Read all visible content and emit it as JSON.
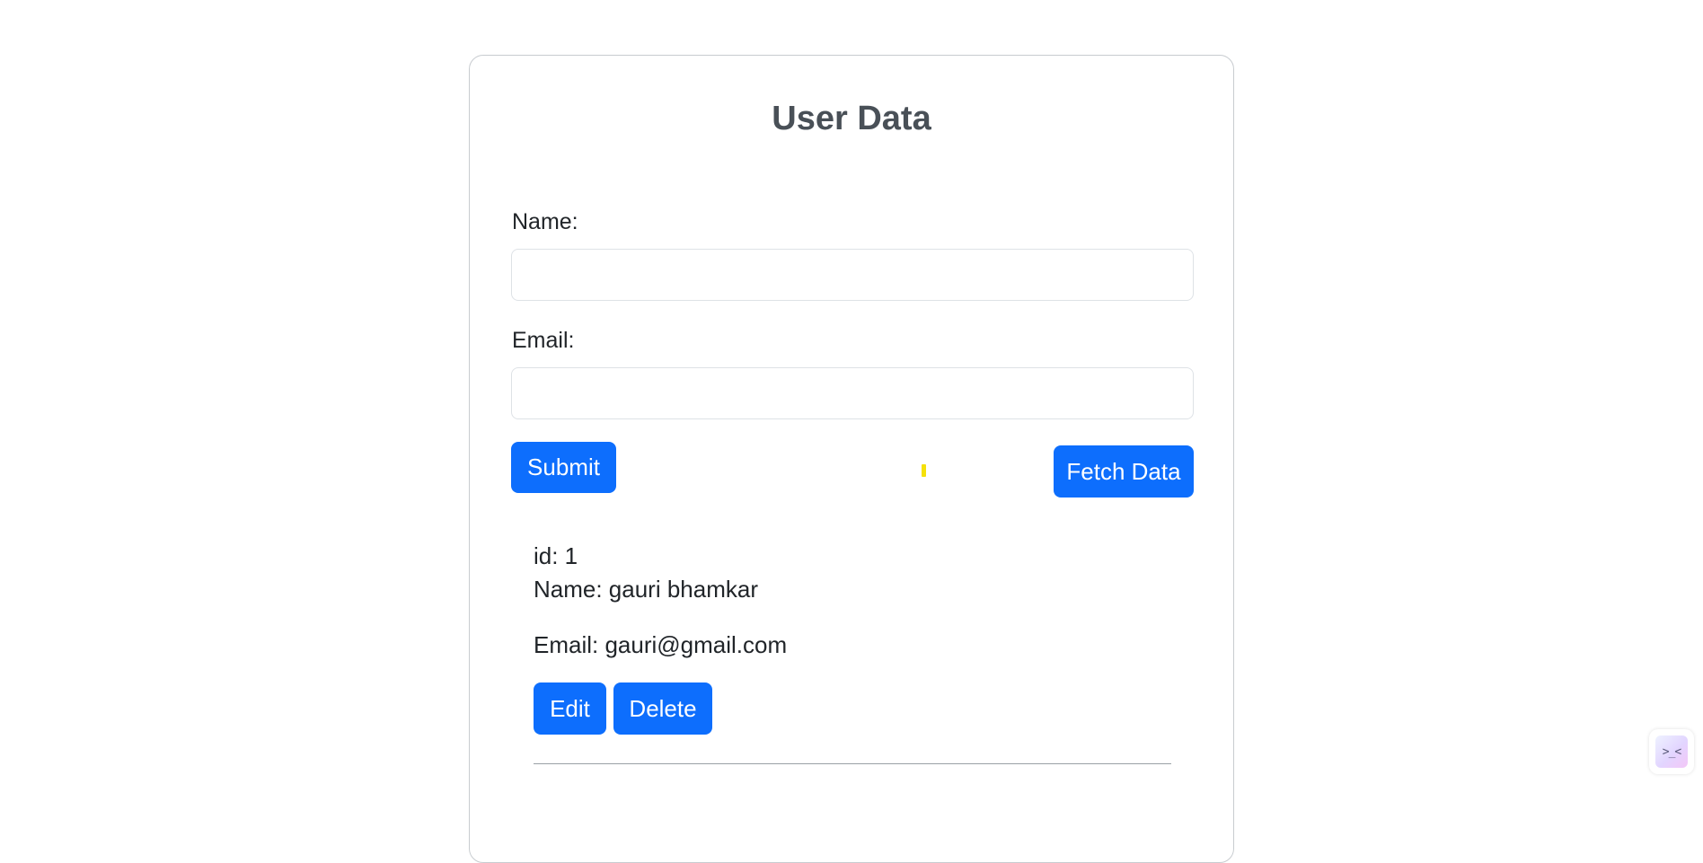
{
  "page": {
    "title": "User Data"
  },
  "form": {
    "name_label": "Name:",
    "name_value": "",
    "name_placeholder": "",
    "email_label": "Email:",
    "email_value": "",
    "email_placeholder": "",
    "submit_label": "Submit",
    "fetch_label": "Fetch Data"
  },
  "user": {
    "id_text": "id: 1",
    "name_text": "Name: gauri bhamkar",
    "email_text": "Email: gauri@gmail.com",
    "edit_label": "Edit",
    "delete_label": "Delete"
  },
  "widget": {
    "face_text": ">_<",
    "icon": "assistant-face-icon"
  },
  "colors": {
    "primary": "#0d6efd",
    "title": "#495057",
    "text": "#212529",
    "loader": "#f5e10a"
  }
}
